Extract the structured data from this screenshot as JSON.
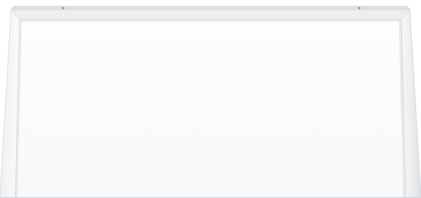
{
  "image": {
    "subject": "led-panel-light",
    "colors": {
      "background": "#ffffff",
      "frame_light": "#f3f4f5",
      "frame_mid": "#e3e5e7",
      "frame_shadow": "#c9ccd0",
      "frame_edge": "#b5b9be",
      "diffuser": "#fbfbfc",
      "diffuser_edge": "#eceef0",
      "top_rail": "#d6d9dc",
      "screw": "#8a8f95"
    }
  }
}
